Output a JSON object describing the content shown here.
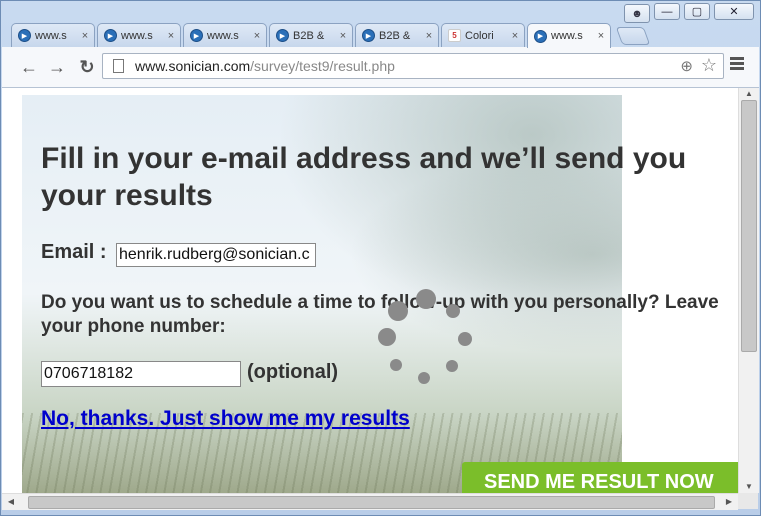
{
  "browser": {
    "tabs": [
      {
        "label": "www.s",
        "icon": "play-circle-icon"
      },
      {
        "label": "www.s",
        "icon": "play-circle-icon"
      },
      {
        "label": "www.s",
        "icon": "play-circle-icon"
      },
      {
        "label": "B2B &",
        "icon": "play-circle-icon"
      },
      {
        "label": "B2B &",
        "icon": "play-circle-icon"
      },
      {
        "label": "Colori",
        "icon": "html5-icon"
      },
      {
        "label": "www.s",
        "icon": "play-circle-icon",
        "active": true
      }
    ],
    "tab_close": "×",
    "address": {
      "host": "www.sonician.com",
      "path": "/survey/test9/result.php"
    }
  },
  "page": {
    "headline": "Fill in your e-mail address and we’ll send you your results",
    "email_label": "Email :",
    "email_value": "henrik.rudberg@sonician.c",
    "question": "Do you want us to schedule a time to follow-up with you personally? Leave your phone number:",
    "phone_value": "0706718182",
    "optional_label": "(optional)",
    "skip_link": "No, thanks. Just show me my results",
    "send_button": "SEND ME RESULT NOW"
  },
  "colors": {
    "send_button": "#7bbe2a",
    "link": "#0000cc",
    "text": "#333333"
  }
}
